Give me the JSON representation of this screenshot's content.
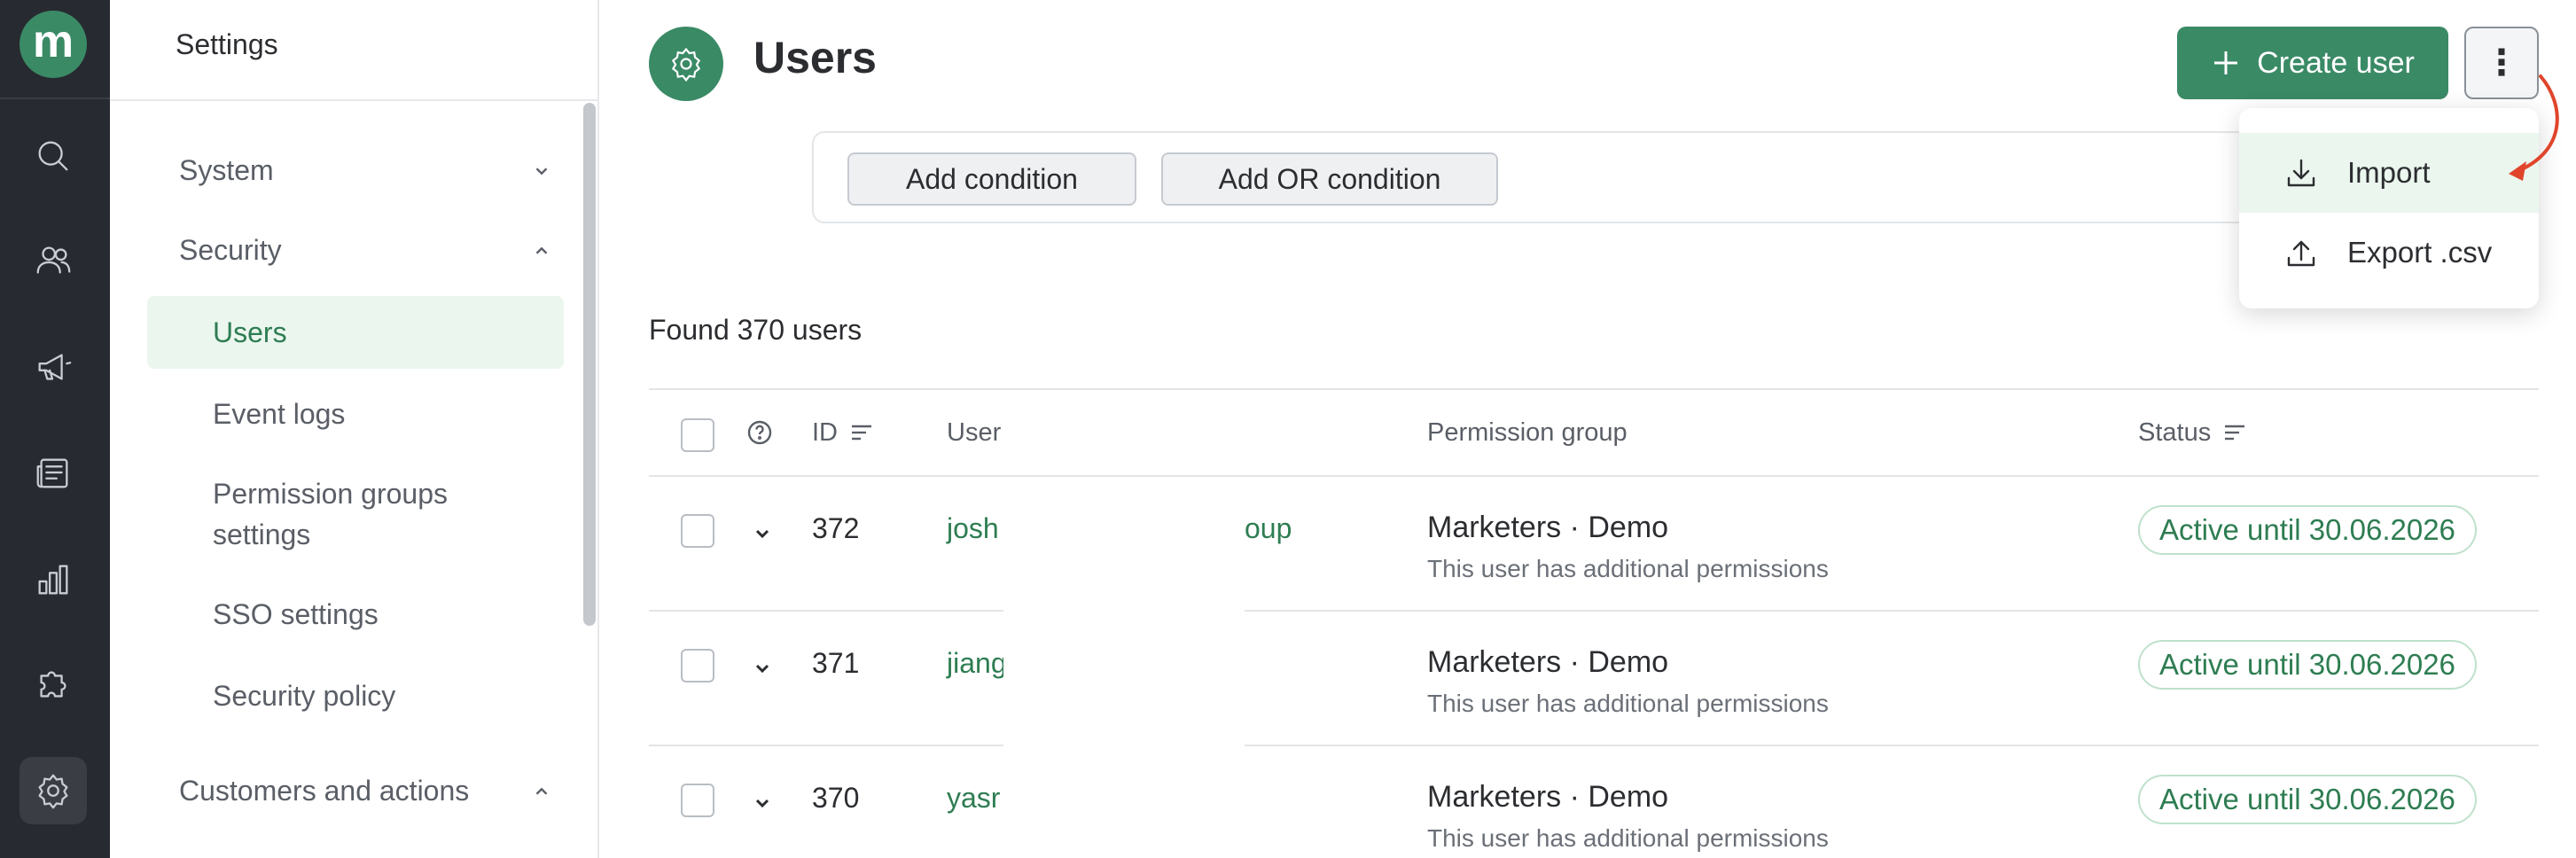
{
  "rail": {
    "logo_letter": "m",
    "items": [
      {
        "icon": "search-icon"
      },
      {
        "icon": "users-icon"
      },
      {
        "icon": "megaphone-icon"
      },
      {
        "icon": "newspaper-icon"
      },
      {
        "icon": "bar-chart-icon"
      },
      {
        "icon": "puzzle-icon"
      },
      {
        "icon": "gear-icon",
        "active": true
      }
    ]
  },
  "sidebar": {
    "title": "Settings",
    "groups": {
      "system": "System",
      "security": "Security",
      "customers": "Customers and actions"
    },
    "security_items": [
      "Users",
      "Event logs",
      "Permission groups settings",
      "SSO settings",
      "Security policy"
    ]
  },
  "header": {
    "title": "Users",
    "create_button": "Create user"
  },
  "filter": {
    "add_condition": "Add condition",
    "add_or_condition": "Add OR condition"
  },
  "summary": "Found 370 users",
  "table": {
    "columns": {
      "id": "ID",
      "user": "User",
      "permission_group": "Permission group",
      "status": "Status"
    },
    "rows": [
      {
        "id": "372",
        "user": "josh",
        "user_suffix": "oup",
        "group": "Marketers · Demo",
        "note": "This user has additional permissions",
        "status": "Active until 30.06.2026"
      },
      {
        "id": "371",
        "user": "jiang",
        "user_suffix": "",
        "group": "Marketers · Demo",
        "note": "This user has additional permissions",
        "status": "Active until 30.06.2026"
      },
      {
        "id": "370",
        "user": "yasr",
        "user_suffix": "",
        "group": "Marketers · Demo",
        "note": "This user has additional permissions",
        "status": "Active until 30.06.2026"
      }
    ]
  },
  "menu": {
    "import": "Import",
    "export": "Export .csv"
  },
  "colors": {
    "brand_green": "#3a8a66",
    "rail_bg": "#272a30",
    "highlight": "#ebf6ee",
    "annotation_arrow": "#e0452b"
  }
}
